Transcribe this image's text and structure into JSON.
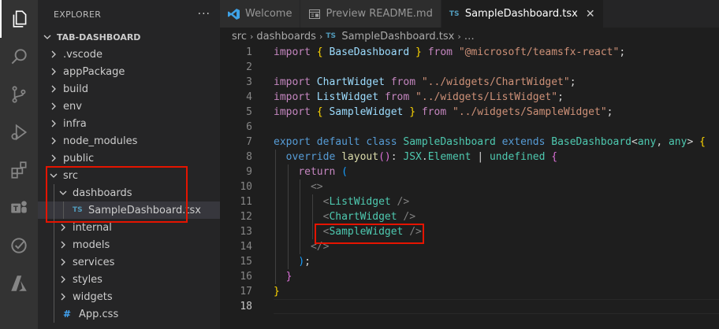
{
  "explorer": {
    "title": "EXPLORER",
    "more": "···",
    "section": "TAB-DASHBOARD",
    "tree": [
      {
        "label": ".vscode",
        "kind": "folder",
        "open": false,
        "depth": 0
      },
      {
        "label": "appPackage",
        "kind": "folder",
        "open": false,
        "depth": 0
      },
      {
        "label": "build",
        "kind": "folder",
        "open": false,
        "depth": 0
      },
      {
        "label": "env",
        "kind": "folder",
        "open": false,
        "depth": 0
      },
      {
        "label": "infra",
        "kind": "folder",
        "open": false,
        "depth": 0
      },
      {
        "label": "node_modules",
        "kind": "folder",
        "open": false,
        "depth": 0
      },
      {
        "label": "public",
        "kind": "folder",
        "open": false,
        "depth": 0
      },
      {
        "label": "src",
        "kind": "folder",
        "open": true,
        "depth": 0
      },
      {
        "label": "dashboards",
        "kind": "folder",
        "open": true,
        "depth": 1
      },
      {
        "label": "SampleDashboard.tsx",
        "kind": "file-ts",
        "selected": true,
        "depth": 2
      },
      {
        "label": "internal",
        "kind": "folder",
        "open": false,
        "depth": 1
      },
      {
        "label": "models",
        "kind": "folder",
        "open": false,
        "depth": 1
      },
      {
        "label": "services",
        "kind": "folder",
        "open": false,
        "depth": 1
      },
      {
        "label": "styles",
        "kind": "folder",
        "open": false,
        "depth": 1
      },
      {
        "label": "widgets",
        "kind": "folder",
        "open": false,
        "depth": 1
      },
      {
        "label": "App.css",
        "kind": "file-css",
        "depth": 1
      }
    ],
    "ts_badge": "TS",
    "css_badge": "#"
  },
  "tabs": [
    {
      "label": "Welcome",
      "icon": "vscode-icon",
      "active": false
    },
    {
      "label": "Preview README.md",
      "icon": "preview-icon",
      "active": false
    },
    {
      "label": "SampleDashboard.tsx",
      "icon": "ts-icon",
      "active": true,
      "close": "✕"
    }
  ],
  "breadcrumbs": [
    "src",
    "dashboards",
    "SampleDashboard.tsx",
    "…"
  ],
  "editor": {
    "current_line": 18,
    "lines": [
      {
        "n": "1"
      },
      {
        "n": "2"
      },
      {
        "n": "3"
      },
      {
        "n": "4"
      },
      {
        "n": "5"
      },
      {
        "n": "6"
      },
      {
        "n": "7"
      },
      {
        "n": "8"
      },
      {
        "n": "9"
      },
      {
        "n": "10"
      },
      {
        "n": "11"
      },
      {
        "n": "12"
      },
      {
        "n": "13"
      },
      {
        "n": "14"
      },
      {
        "n": "15"
      },
      {
        "n": "16"
      },
      {
        "n": "17"
      },
      {
        "n": "18"
      }
    ],
    "tokens": {
      "l1": [
        "import",
        "{",
        "BaseDashboard",
        "}",
        "from",
        "\"@microsoft/teamsfx-react\"",
        ";"
      ],
      "l3": [
        "import",
        "ChartWidget",
        "from",
        "\"../widgets/ChartWidget\"",
        ";"
      ],
      "l4": [
        "import",
        "ListWidget",
        "from",
        "\"../widgets/ListWidget\"",
        ";"
      ],
      "l5": [
        "import",
        "{",
        "SampleWidget",
        "}",
        "from",
        "\"../widgets/SampleWidget\"",
        ";"
      ],
      "l7": [
        "export",
        "default",
        "class",
        "SampleDashboard",
        "extends",
        "BaseDashboard",
        "<",
        "any",
        ",",
        "any",
        ">",
        "{"
      ],
      "l8": [
        "override",
        "layout",
        "()",
        ":",
        "JSX",
        ".",
        "Element",
        "|",
        "undefined",
        "{"
      ],
      "l9": [
        "return",
        "("
      ],
      "l10": [
        "<>"
      ],
      "l11": [
        "<",
        "ListWidget",
        " />"
      ],
      "l12": [
        "<",
        "ChartWidget",
        " />"
      ],
      "l13": [
        "<",
        "SampleWidget",
        " />"
      ],
      "l14": [
        "</>"
      ],
      "l15": [
        ")",
        ";"
      ],
      "l16": [
        "}"
      ],
      "l17": [
        "}"
      ]
    }
  },
  "colors": {
    "activity_bar": "#333333",
    "sidebar": "#252526",
    "editor_bg": "#1e1e1e",
    "highlight": "#e51400",
    "keyword": "#569cd6",
    "control": "#c586c0",
    "string": "#ce9178",
    "type": "#4ec9b0"
  },
  "activity_icons": [
    "explorer-icon",
    "search-icon",
    "source-control-icon",
    "run-debug-icon",
    "extensions-icon",
    "teams-toolkit-icon",
    "testing-icon",
    "azure-icon"
  ]
}
